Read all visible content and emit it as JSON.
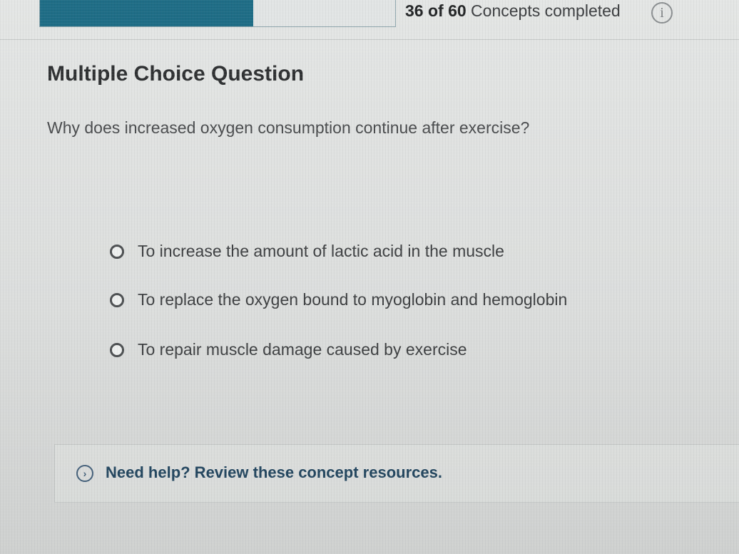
{
  "progress": {
    "completed": 36,
    "total": 60,
    "count_text": "36 of 60",
    "suffix_text": " Concepts completed",
    "fill_color": "#1f6d86",
    "info_icon": "i"
  },
  "question": {
    "type_label": "Multiple Choice Question",
    "prompt": "Why does increased oxygen consumption continue after exercise?",
    "options": [
      {
        "label": "To increase the amount of lactic acid in the muscle",
        "selected": false
      },
      {
        "label": "To replace the oxygen bound to myoglobin and hemoglobin",
        "selected": false
      },
      {
        "label": "To repair muscle damage caused by exercise",
        "selected": false
      }
    ]
  },
  "help": {
    "icon": "chevron-right-circle-icon",
    "link_text": "Need help? Review these concept resources."
  }
}
